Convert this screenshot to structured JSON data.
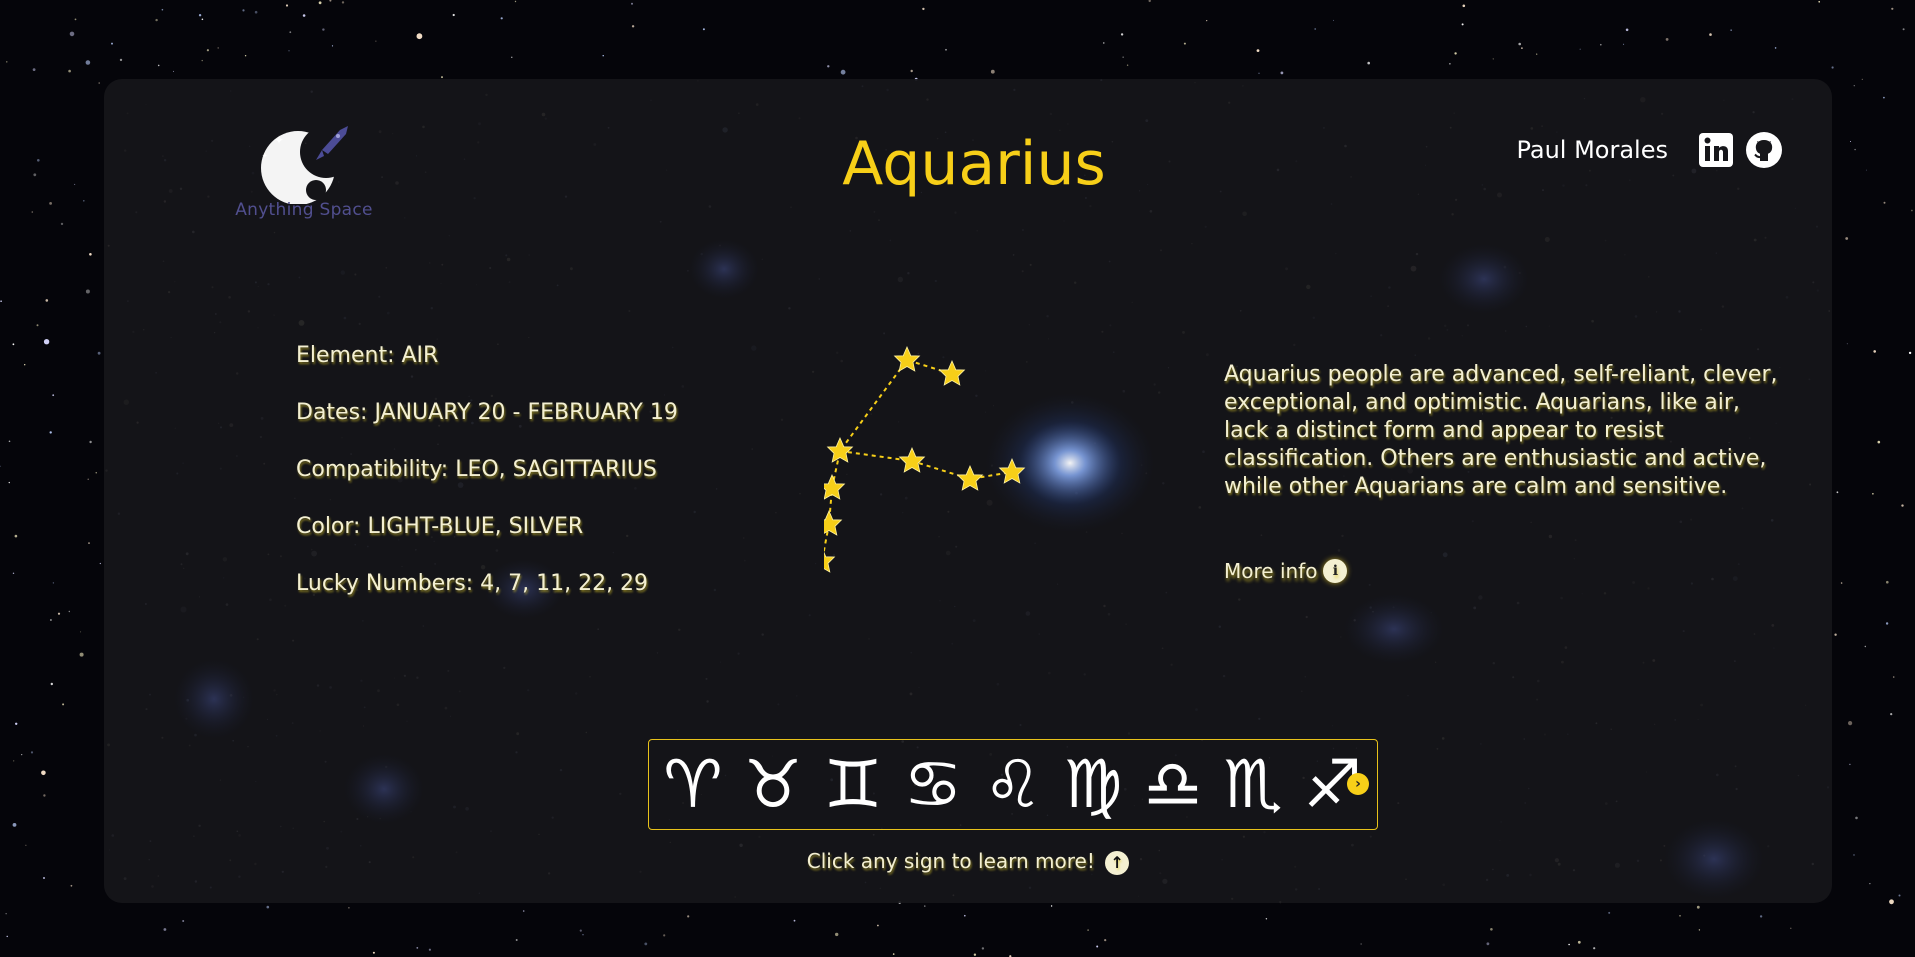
{
  "logo": {
    "text": "Anything Space",
    "icon": "rocket-moon-icon"
  },
  "title": "Aquarius",
  "author": "Paul Morales",
  "social": [
    {
      "name": "linkedin-icon"
    },
    {
      "name": "github-icon"
    }
  ],
  "info": {
    "element": "Element: AIR",
    "dates": "Dates: JANUARY 20 - FEBRUARY 19",
    "compatibility": "Compatibility: LEO, SAGITTARIUS",
    "color": "Color: LIGHT-BLUE, SILVER",
    "lucky": "Lucky Numbers: 4, 7, 11, 22, 29"
  },
  "description": "Aquarius people are advanced, self-reliant, clever, exceptional, and optimistic. Aquarians, like air, lack a distinct form and appear to resist classification. Others are enthusiastic and active, while other Aquarians are calm and sensitive.",
  "more_info": {
    "label": "More info",
    "icon": "i"
  },
  "signs": [
    {
      "glyph": "♈",
      "name": "aries"
    },
    {
      "glyph": "♉",
      "name": "taurus"
    },
    {
      "glyph": "♊",
      "name": "gemini"
    },
    {
      "glyph": "♋",
      "name": "cancer"
    },
    {
      "glyph": "♌",
      "name": "leo"
    },
    {
      "glyph": "♍",
      "name": "virgo"
    },
    {
      "glyph": "♎",
      "name": "libra"
    },
    {
      "glyph": "♏",
      "name": "scorpio"
    },
    {
      "glyph": "♐",
      "name": "sagittarius"
    }
  ],
  "next_arrow": "›",
  "hint": {
    "text": "Click any sign to learn more!",
    "icon": "↑"
  },
  "colors": {
    "accent": "#f7cf18",
    "text": "#f4f0d2",
    "panel": "#16161a"
  }
}
